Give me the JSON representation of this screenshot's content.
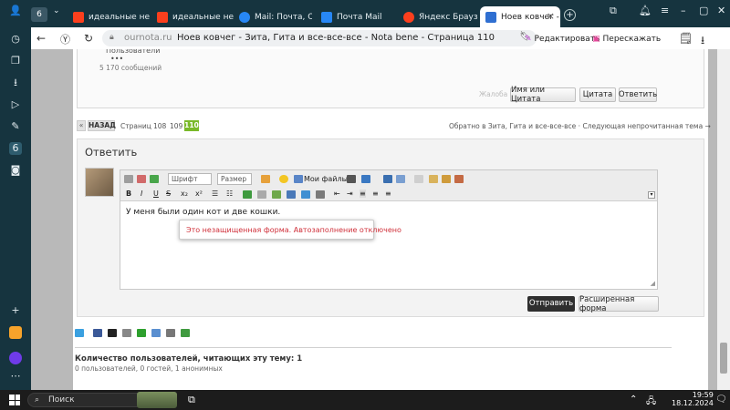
{
  "browser": {
    "tabs": [
      {
        "label": "идеальные незнако",
        "favicon_color": "#fc3f1d"
      },
      {
        "label": "идеальные незнако",
        "favicon_color": "#fc3f1d"
      },
      {
        "label": "Mail: Почта, Обла",
        "favicon_color": "#2787f5"
      },
      {
        "label": "Почта Mail",
        "favicon_color": "#2787f5"
      },
      {
        "label": "Яндекс Браузер д",
        "favicon_color": "#fc3f1d"
      },
      {
        "label": "Ноев ковчег - З",
        "favicon_color": "#2f6fd1"
      }
    ],
    "address": {
      "domain": "ournota.ru",
      "title": "Ноев ковчег - Зита, Гита и все-все-все - Nota bene - Страница 110"
    },
    "actions": {
      "edit": "Редактировать",
      "retell": "Перескажать"
    }
  },
  "post": {
    "role": "Пользователи",
    "dots": "•••",
    "message_count": "5 170 сообщений",
    "complaint": "Жалоба",
    "buttons": [
      "Имя или Цитата",
      "Цитата",
      "Ответить"
    ]
  },
  "pager": {
    "prev_arrow": "«",
    "back": "НАЗАД",
    "pages_label": "Страниц",
    "pages": [
      "108",
      "109"
    ],
    "current": "110",
    "nav_text": "Обратно в Зита, Гита и все-все-все · Следующая непрочитанная тема →"
  },
  "reply": {
    "heading": "Ответить",
    "font_select": "Шрифт",
    "size_select": "Размер",
    "my_files": "Мои файлы",
    "body_text": "У меня были один кот и две кошки.",
    "autofill_warning": "Это незащищенная форма. Автозаполнение отключено",
    "send": "Отправить",
    "advanced": "Расширенная форма"
  },
  "footer": {
    "readers_title": "Количество пользователей, читающих эту тему: 1",
    "readers_detail": "0 пользователей, 0 гостей, 1 анонимных"
  },
  "taskbar": {
    "search": "Поиск",
    "time": "19:59",
    "date": "18.12.2024"
  },
  "colors": {
    "accent_green": "#7ab929",
    "send_button": "#2f2f2f",
    "warning_red": "#d0303a"
  }
}
